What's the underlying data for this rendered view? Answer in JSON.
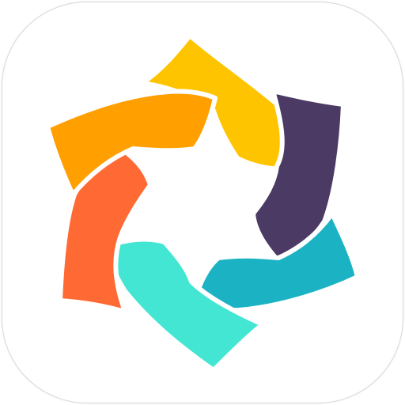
{
  "app_icon": {
    "icon": "pinwheel-logo-icon",
    "background": "#ffffff",
    "border_color": "#d8d8d8",
    "petals": [
      {
        "name": "yellow",
        "color": "#ffc400"
      },
      {
        "name": "purple",
        "color": "#4b3a64"
      },
      {
        "name": "teal",
        "color": "#1bb3c3"
      },
      {
        "name": "mint",
        "color": "#43e6d2"
      },
      {
        "name": "red-orange",
        "color": "#ff6a34"
      },
      {
        "name": "orange",
        "color": "#ff9f00"
      }
    ]
  }
}
